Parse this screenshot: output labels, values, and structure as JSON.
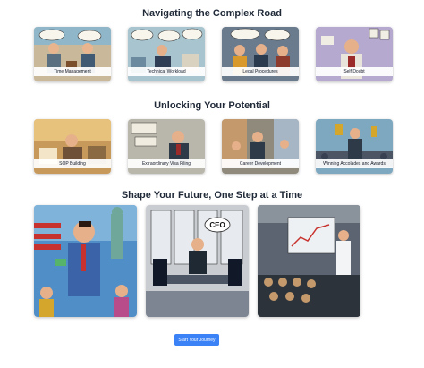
{
  "sections": [
    {
      "title": "Navigating the Complex Road",
      "cards": [
        {
          "label": "Time Management"
        },
        {
          "label": "Technical Workload"
        },
        {
          "label": "Legal Procedures"
        },
        {
          "label": "Self Doubt"
        }
      ]
    },
    {
      "title": "Unlocking Your Potential",
      "cards": [
        {
          "label": "SOP Building"
        },
        {
          "label": "Extraordinary Visa Filing"
        },
        {
          "label": "Career Development"
        },
        {
          "label": "Winning Accolades and Awards"
        }
      ]
    },
    {
      "title": "Shape Your Future, One Step at a Time",
      "images": [
        {
          "name": "statue-of-liberty-success-image"
        },
        {
          "name": "ceo-boardroom-image",
          "text": "CEO"
        },
        {
          "name": "conference-presentation-image"
        }
      ]
    }
  ],
  "cta": {
    "label": "Start Your Journey",
    "color": "#3b82f6"
  }
}
